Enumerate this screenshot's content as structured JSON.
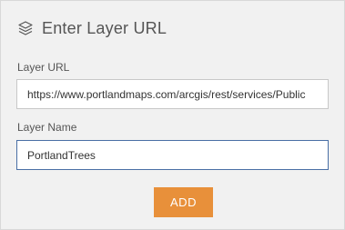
{
  "header": {
    "title": "Enter Layer URL",
    "icon": "layers-icon"
  },
  "layer_url": {
    "label": "Layer URL",
    "value": "https://www.portlandmaps.com/arcgis/rest/services/Public"
  },
  "layer_name": {
    "label": "Layer Name",
    "value": "PortlandTrees"
  },
  "actions": {
    "add_label": "ADD"
  },
  "colors": {
    "accent": "#e8903a",
    "focus_border": "#4a6fa5",
    "background": "#f1f1f1"
  }
}
